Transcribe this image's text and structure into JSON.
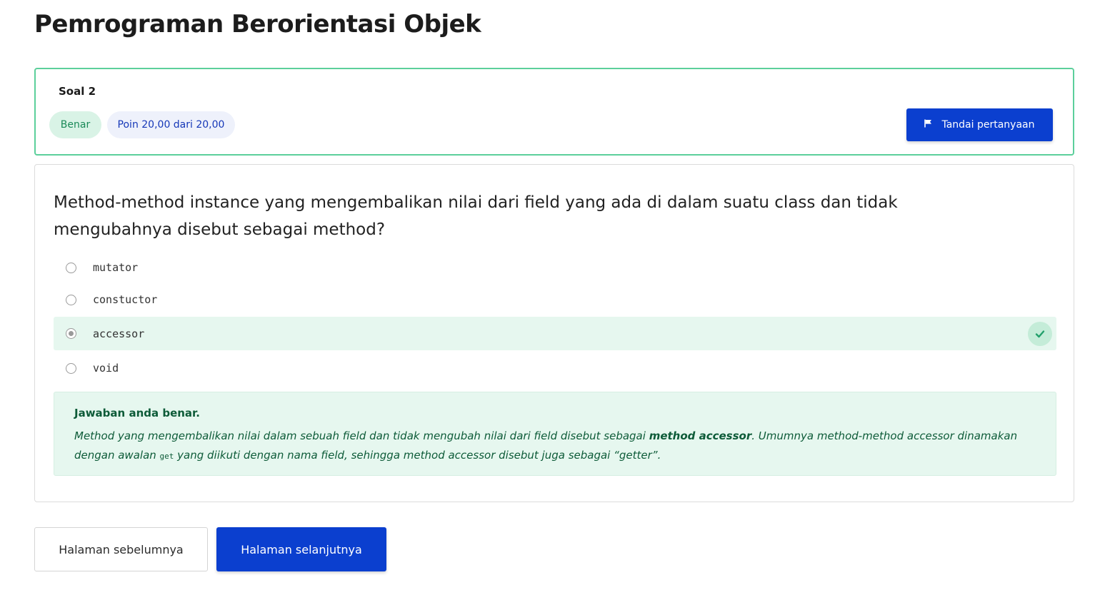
{
  "page": {
    "title": "Pemrograman Berorientasi Objek"
  },
  "question_info": {
    "number_label": "Soal 2",
    "status": "Benar",
    "points": "Poin 20,00 dari 20,00",
    "flag_label": "Tandai pertanyaan"
  },
  "question": {
    "text": "Method-method instance yang mengembalikan nilai dari field yang ada di dalam suatu class dan tidak mengubahnya disebut sebagai method?",
    "options": [
      {
        "label": "mutator",
        "selected": false
      },
      {
        "label": "constuctor",
        "selected": false
      },
      {
        "label": "accessor",
        "selected": true,
        "correct": true
      },
      {
        "label": "void",
        "selected": false
      }
    ]
  },
  "feedback": {
    "title": "Jawaban anda benar.",
    "part1": "Method yang mengembalikan nilai dalam sebuah field dan tidak mengubah nilai dari field disebut sebagai ",
    "bold": "method accessor",
    "part2": ". Umumnya method-method accessor dinamakan dengan awalan ",
    "code": "get",
    "part3": " yang diikuti dengan nama field, sehingga method accessor disebut juga sebagai “getter”."
  },
  "navigation": {
    "prev_label": "Halaman sebelumnya",
    "next_label": "Halaman selanjutnya"
  },
  "icons": {
    "flag": "flag-icon",
    "check": "check-icon",
    "radio": "radio-icon"
  },
  "colors": {
    "accent": "#0b3fcf",
    "success_border": "#5ccf9b",
    "success_bg": "#e6f7ef",
    "success_text": "#0d5b38"
  }
}
